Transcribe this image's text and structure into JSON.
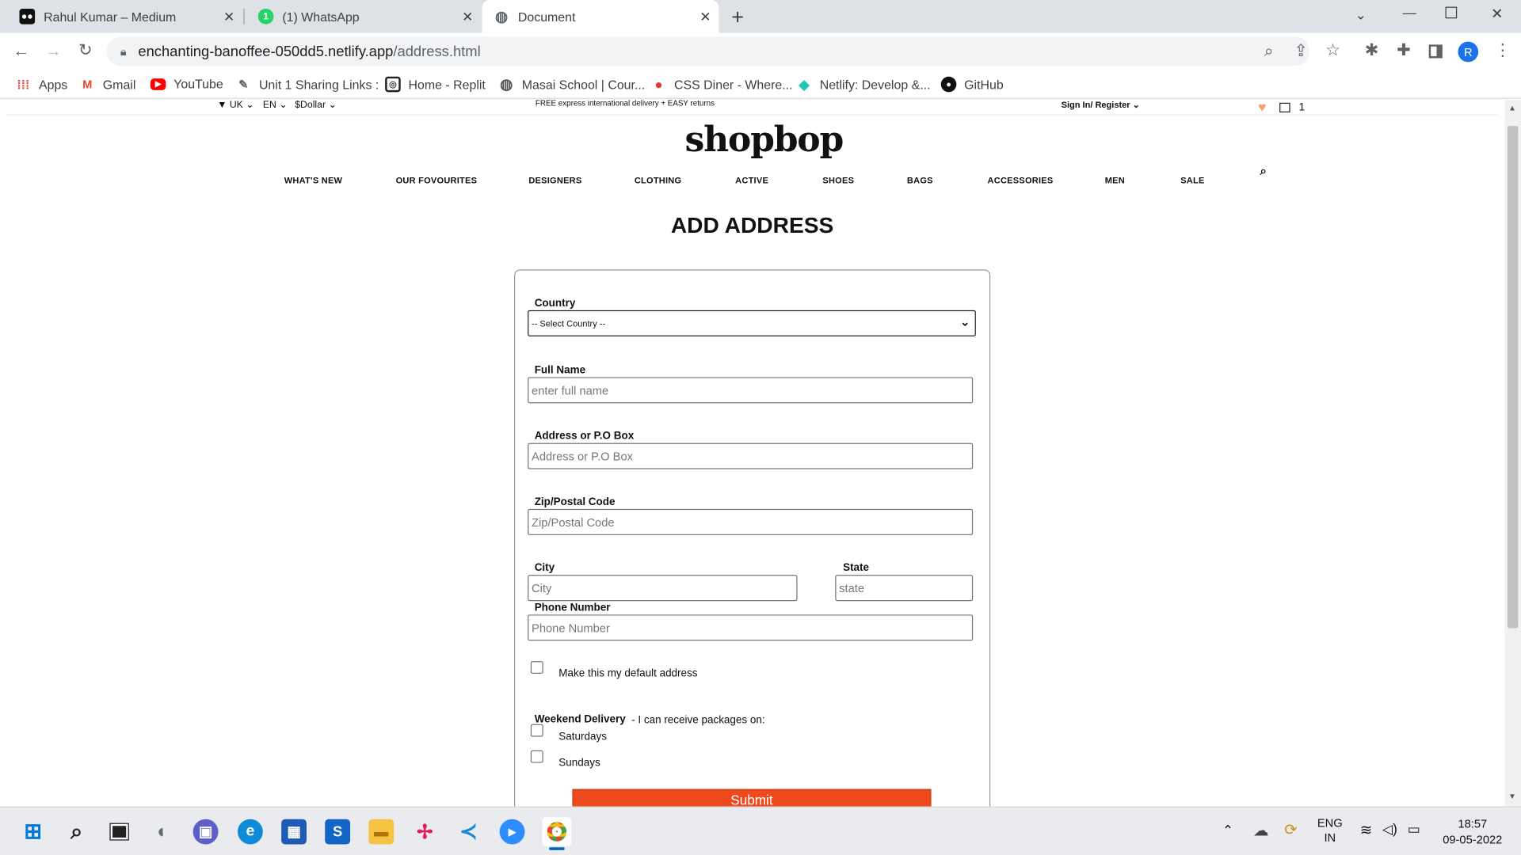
{
  "browser": {
    "tabs": [
      {
        "title": "Rahul Kumar – Medium",
        "icon": "medium-icon"
      },
      {
        "title": "(1) WhatsApp",
        "icon": "whatsapp-icon",
        "badge": "1"
      },
      {
        "title": "Document",
        "icon": "globe-icon",
        "active": true
      }
    ],
    "new_tab": "+",
    "url_host": "enchanting-banoffee-050dd5.netlify.app",
    "url_path": "/address.html",
    "profile_initial": "R",
    "bookmarks": [
      {
        "label": "Apps",
        "icon": "apps-grid-icon"
      },
      {
        "label": "Gmail",
        "icon": "gmail-icon"
      },
      {
        "label": "YouTube",
        "icon": "youtube-icon"
      },
      {
        "label": "Unit 1 Sharing Links :",
        "icon": "pencil-icon"
      },
      {
        "label": "Home - Replit",
        "icon": "replit-icon"
      },
      {
        "label": "Masai School | Cour...",
        "icon": "globe-icon"
      },
      {
        "label": "CSS Diner - Where...",
        "icon": "css-diner-icon"
      },
      {
        "label": "Netlify: Develop &...",
        "icon": "netlify-icon"
      },
      {
        "label": "GitHub",
        "icon": "github-icon"
      }
    ]
  },
  "site": {
    "topbar": {
      "region": "UK",
      "language": "EN",
      "currency": "$Dollar",
      "promo": "FREE express international delivery + EASY returns",
      "signin": "Sign In/ Register",
      "cart_count": "1"
    },
    "logo": "shopbop",
    "nav": [
      "WHAT'S NEW",
      "OUR FOVOURITES",
      "DESIGNERS",
      "CLOTHING",
      "ACTIVE",
      "SHOES",
      "BAGS",
      "ACCESSORIES",
      "MEN",
      "SALE"
    ]
  },
  "form": {
    "title": "ADD ADDRESS",
    "country_label": "Country",
    "country_value": "-- Select Country --",
    "fullname_label": "Full Name",
    "fullname_placeholder": "enter full name",
    "address_label": "Address or P.O Box",
    "address_placeholder": "Address or P.O Box",
    "zip_label": "Zip/Postal Code",
    "zip_placeholder": "Zip/Postal Code",
    "city_label": "City",
    "city_placeholder": "City",
    "state_label": "State",
    "state_placeholder": "state",
    "phone_label": "Phone Number",
    "phone_placeholder": "Phone Number",
    "default_label": "Make this my default address",
    "weekend_label": "Weekend Delivery",
    "weekend_note": "- I can receive packages on:",
    "saturday_label": "Saturdays",
    "sunday_label": "Sundays",
    "submit_label": "Submit"
  },
  "taskbar": {
    "language": "ENG",
    "region": "IN",
    "time": "18:57",
    "date": "09-05-2022"
  },
  "colors": {
    "submit": "#ee4a1d",
    "tabstrip": "#dee1e6",
    "profile": "#1a73e8"
  }
}
